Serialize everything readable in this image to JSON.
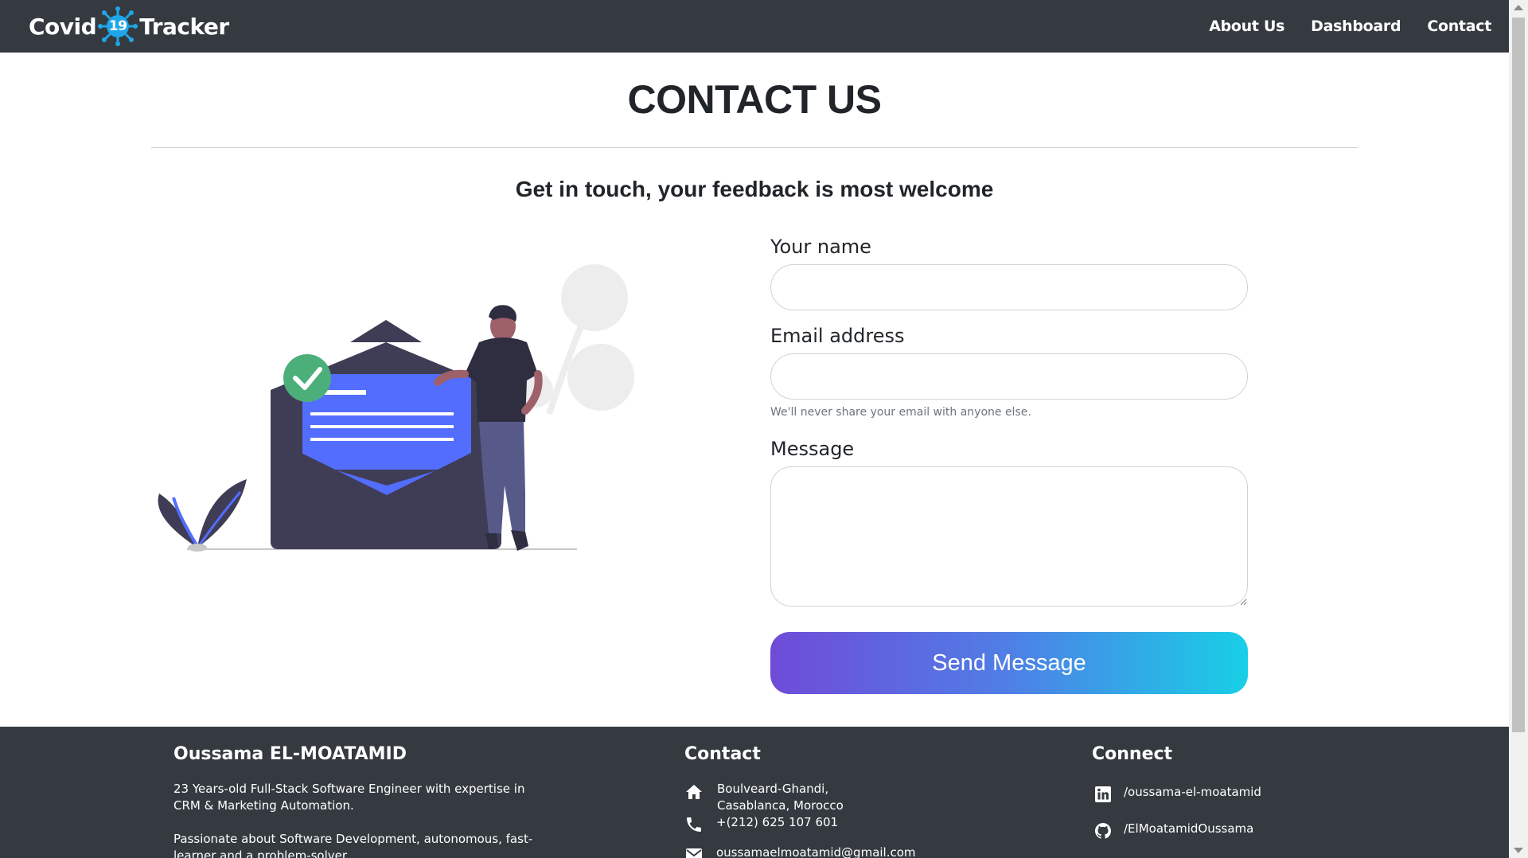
{
  "brand": {
    "left": "Covid",
    "number": "19",
    "right": "Tracker"
  },
  "nav": {
    "items": [
      "About Us",
      "Dashboard",
      "Contact"
    ]
  },
  "main": {
    "title": "CONTACT US",
    "subtitle": "Get in touch, your feedback is most welcome"
  },
  "form": {
    "name_label": "Your name",
    "name_value": "",
    "email_label": "Email address",
    "email_value": "",
    "email_help": "We'll never share your email with anyone else.",
    "message_label": "Message",
    "message_value": "",
    "send_label": "Send Message"
  },
  "footer": {
    "about": {
      "title": "Oussama EL-MOATAMID",
      "line1": "23 Years-old Full-Stack Software Engineer with expertise in",
      "line2": "CRM & Marketing Automation.",
      "line3": "Passionate about Software Development, autonomous, fast-",
      "line4": "learner and a problem-solver."
    },
    "contact": {
      "title": "Contact",
      "address_line1": "Boulveard-Ghandi,",
      "address_line2": "Casablanca, Morocco",
      "phone": "+(212) 625 107 601",
      "email": "oussamaelmoatamid@gmail.com"
    },
    "connect": {
      "title": "Connect",
      "linkedin": "/oussama-el-moatamid",
      "github": "/ElMoatamidOussama"
    }
  },
  "colors": {
    "navbar": "#343a40",
    "footer": "#343a40",
    "button_gradient_start": "#6f4bd8",
    "button_gradient_end": "#18cfe6",
    "illustration_accent": "#536dfe",
    "check_green": "#4caf7a",
    "envelope_dark": "#3f3d56"
  }
}
